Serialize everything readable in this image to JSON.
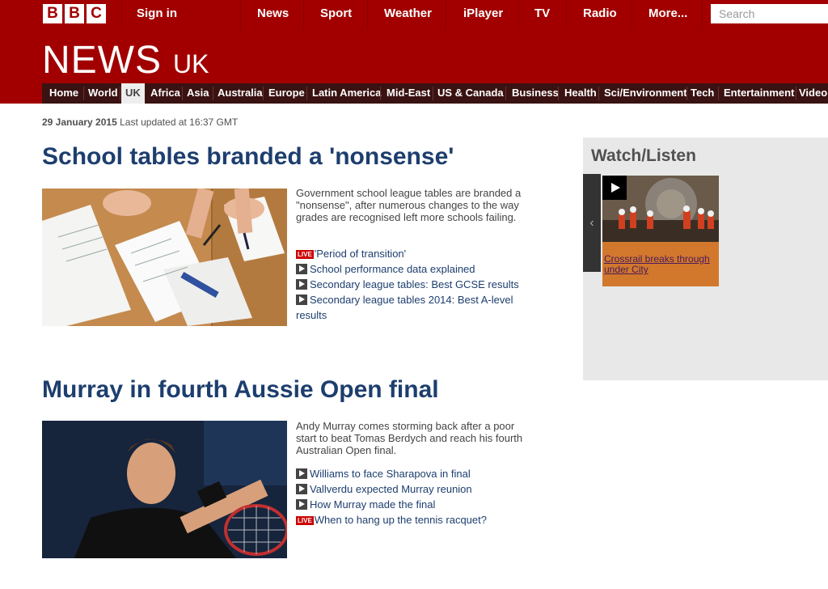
{
  "header": {
    "logo_letters": [
      "B",
      "B",
      "C"
    ],
    "sign_in": "Sign in",
    "nav": [
      "News",
      "Sport",
      "Weather",
      "iPlayer",
      "TV",
      "Radio",
      "More..."
    ],
    "search_placeholder": "Search"
  },
  "masthead": {
    "title": "NEWS",
    "region": "UK",
    "sections": [
      "Home",
      "World",
      "UK",
      "Africa",
      "Asia",
      "Australia",
      "Europe",
      "Latin America",
      "Mid-East",
      "US & Canada",
      "Business",
      "Health",
      "Sci/Environment",
      "Tech",
      "Entertainment",
      "Video"
    ],
    "active_section": "UK"
  },
  "meta": {
    "date": "29 January 2015",
    "updated": "Last updated at 16:37 GMT"
  },
  "stories": [
    {
      "headline": "School tables branded a 'nonsense'",
      "summary": "Government school league tables are branded a \"nonsense\", after numerous changes to the way grades are recognised left more schools failing.",
      "related": [
        {
          "type": "live",
          "label": "LIVE",
          "text": "'Period of transition'"
        },
        {
          "type": "video",
          "text": "School performance data explained"
        },
        {
          "type": "video",
          "text": "Secondary league tables: Best GCSE results"
        },
        {
          "type": "video",
          "text": "Secondary league tables 2014: Best A-level results"
        }
      ]
    },
    {
      "headline": "Murray in fourth Aussie Open final",
      "summary": "Andy Murray comes storming back after a poor start to beat Tomas Berdych and reach his fourth Australian Open final.",
      "related": [
        {
          "type": "video",
          "text": "Williams to face Sharapova in final"
        },
        {
          "type": "video",
          "text": "Vallverdu expected Murray reunion"
        },
        {
          "type": "video",
          "text": "How Murray made the final"
        },
        {
          "type": "live",
          "label": "LIVE",
          "text": "When to hang up the tennis racquet?"
        }
      ]
    }
  ],
  "sidebar": {
    "title": "Watch/Listen",
    "prev_arrow": "‹",
    "item_caption": "Crossrail breaks through under City"
  },
  "colors": {
    "brand_red": "#a20000",
    "headline_blue": "#1d3e6e",
    "live_red": "#cc0000",
    "caption_orange": "#d2782d"
  }
}
